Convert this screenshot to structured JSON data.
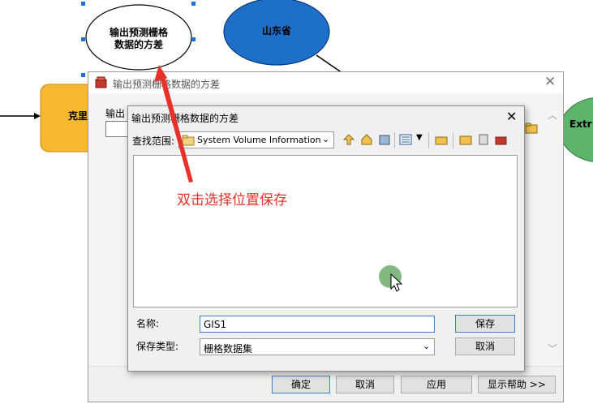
{
  "model": {
    "node_output": "输出预测栅格\n数据的方差",
    "node_province": "山东省",
    "node_kriging": "克里",
    "node_extract": "Extr"
  },
  "outer_dialog": {
    "title": "输出预测栅格数据的方差",
    "field_label": "输出",
    "ok": "确定",
    "cancel": "取消",
    "apply": "应用",
    "help": "显示帮助 >>"
  },
  "inner_dialog": {
    "title": "输出预测栅格数据的方差",
    "look_in_label": "查找范围:",
    "look_in_value": "System Volume Information",
    "name_label": "名称:",
    "name_value": "GIS1",
    "type_label": "保存类型:",
    "type_value": "栅格数据集",
    "save": "保存",
    "cancel": "取消"
  },
  "annotation": {
    "text": "双击选择位置保存",
    "color": "#e8312a"
  },
  "colors": {
    "node_blue": "#1e6fc8",
    "node_yellow": "#f7b731",
    "node_green": "#5cb56a"
  }
}
